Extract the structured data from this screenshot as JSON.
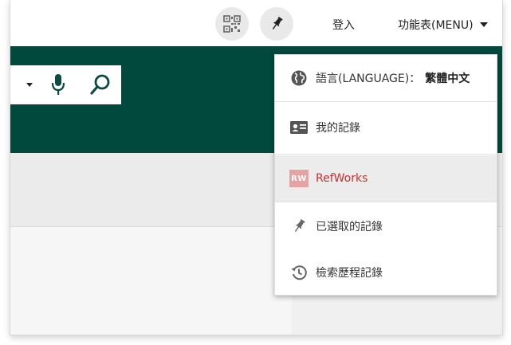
{
  "header": {
    "signin_label": "登入",
    "menu_label": "功能表(MENU)"
  },
  "dropdown": {
    "language_label": "語言(LANGUAGE)：",
    "language_value": "繁體中文",
    "my_records": "我的記錄",
    "refworks": "RefWorks",
    "refworks_badge": "RW",
    "selected_records": "已選取的記錄",
    "search_history": "檢索歷程記錄"
  },
  "colors": {
    "brand_green": "#00493c",
    "refworks_red": "#c9302c",
    "refworks_badge": "#e6a3a3"
  },
  "icons": [
    "qr-code-icon",
    "pin-icon",
    "caret-down-icon",
    "microphone-icon",
    "search-icon",
    "globe-icon",
    "id-card-icon",
    "refworks-icon",
    "pin-icon",
    "history-icon"
  ]
}
